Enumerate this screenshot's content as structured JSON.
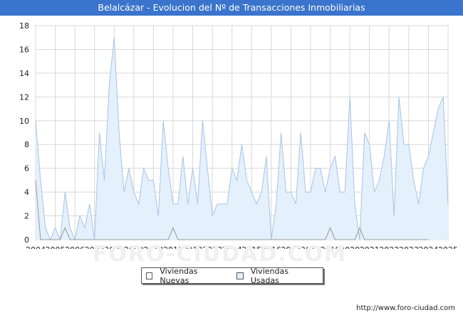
{
  "title": "Belalcázar - Evolucion del Nº de Transacciones Inmobiliarias",
  "footer_url": "http://www.foro-ciudad.com",
  "watermark": "FORO-CIUDAD.COM",
  "chart_data": {
    "type": "area",
    "title": "Belalcázar - Evolucion del Nº de Transacciones Inmobiliarias",
    "xlabel": "",
    "ylabel": "",
    "ylim": [
      0,
      18
    ],
    "yticks": [
      0,
      2,
      4,
      6,
      8,
      10,
      12,
      14,
      16,
      18
    ],
    "xticks": [
      "2004",
      "2005",
      "2006",
      "2007",
      "2008",
      "2009",
      "2010",
      "2011",
      "2012",
      "2013",
      "2014",
      "2015",
      "2016",
      "2017",
      "2018",
      "2019",
      "2020",
      "2021",
      "2022",
      "2023",
      "2024",
      "2025"
    ],
    "grid": true,
    "legend_position": "bottom-center",
    "periods_per_year": 4,
    "series": [
      {
        "name": "Viviendas Nuevas",
        "color": "#999999",
        "fill": "#ffffff",
        "values": [
          5,
          0,
          0,
          0,
          0,
          0,
          1,
          0,
          0,
          0,
          0,
          0,
          0,
          0,
          0,
          0,
          0,
          0,
          0,
          0,
          0,
          0,
          0,
          0,
          0,
          0,
          0,
          0,
          1,
          0,
          0,
          0,
          0,
          0,
          0,
          0,
          0,
          0,
          0,
          0,
          0,
          0,
          0,
          0,
          0,
          0,
          0,
          0,
          0,
          0,
          0,
          0,
          0,
          0,
          0,
          0,
          0,
          0,
          0,
          0,
          1,
          0,
          0,
          0,
          0,
          0,
          1,
          0,
          0,
          0,
          0,
          0,
          0,
          0,
          0,
          0,
          0,
          0,
          0,
          0,
          0
        ]
      },
      {
        "name": "Viviendas Usadas",
        "color": "#a8c4e4",
        "fill": "#e4f0fc",
        "values": [
          10,
          5,
          1,
          0,
          1,
          0,
          4,
          1,
          0,
          2,
          1,
          3,
          0,
          9,
          5,
          13,
          17,
          9,
          4,
          6,
          4,
          3,
          6,
          5,
          5,
          2,
          10,
          6,
          3,
          3,
          7,
          3,
          6,
          3,
          10,
          6,
          2,
          3,
          3,
          3,
          6,
          5,
          8,
          5,
          4,
          3,
          4,
          7,
          0,
          3,
          9,
          4,
          4,
          3,
          9,
          4,
          4,
          6,
          6,
          4,
          6,
          7,
          4,
          4,
          12,
          3,
          0,
          9,
          8,
          4,
          5,
          7,
          10,
          2,
          12,
          8,
          8,
          5,
          3,
          6,
          7,
          9,
          11,
          12,
          3
        ]
      }
    ]
  }
}
